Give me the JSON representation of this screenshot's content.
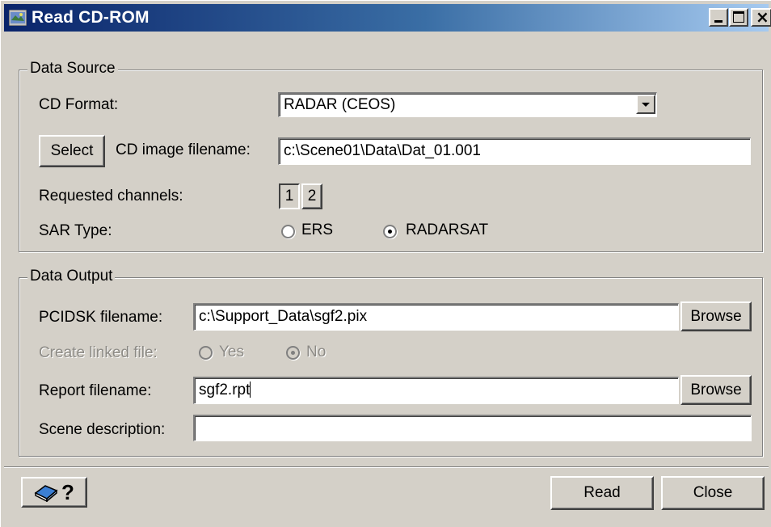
{
  "window": {
    "title": "Read CD-ROM",
    "minimize_glyph": "",
    "close_glyph": "×"
  },
  "data_source": {
    "group_title": "Data Source",
    "cd_format_label": "CD Format:",
    "cd_format_value": "RADAR (CEOS)",
    "select_button": "Select",
    "cd_image_label": "CD image filename:",
    "cd_image_value": "c:\\Scene01\\Data\\Dat_01.001",
    "requested_channels_label": "Requested channels:",
    "channels": [
      "1",
      "2"
    ],
    "sar_type_label": "SAR Type:",
    "sar_options": [
      {
        "label": "ERS",
        "checked": false
      },
      {
        "label": "RADARSAT",
        "checked": true
      }
    ]
  },
  "data_output": {
    "group_title": "Data Output",
    "pcidsk_label": "PCIDSK filename:",
    "pcidsk_value": "c:\\Support_Data\\sgf2.pix",
    "browse_label": "Browse",
    "linked_label": "Create linked file:",
    "linked_options": [
      {
        "label": "Yes",
        "checked": false
      },
      {
        "label": "No",
        "checked": true
      }
    ],
    "report_label": "Report filename:",
    "report_value": "sgf2.rpt",
    "scene_label": "Scene description:",
    "scene_value": ""
  },
  "footer": {
    "help_glyph": "?",
    "read_button": "Read",
    "close_button": "Close"
  }
}
